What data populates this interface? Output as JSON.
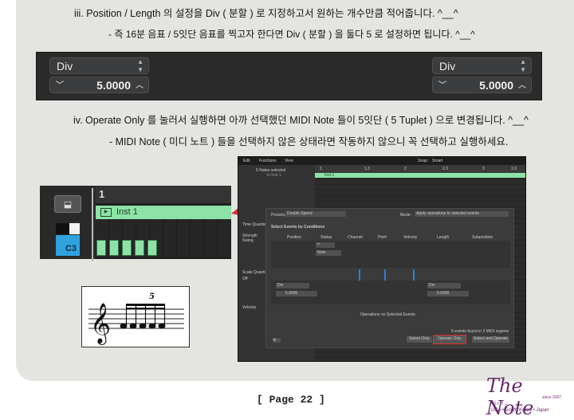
{
  "step3": {
    "line1": "iii. Position / Length 의 설정을 Div ( 분할 ) 로 지정하고서 원하는 개수만큼 적어줍니다. ^__^",
    "line2": "- 즉 16분 음표 / 5잇단 음표를 찍고자 한다면 Div ( 분할 ) 을 둘다 5 로 설정하면 됩니다. ^__^"
  },
  "div_bar": {
    "left_mode": "Div",
    "left_value": "5.0000",
    "right_mode": "Div",
    "right_value": "5.0000"
  },
  "step4": {
    "line1": "iv. Operate Only 를 눌러서 실행하면 아까 선택했던 MIDI Note 들이 5잇단 ( 5 Tuplet ) 으로 변경됩니다. ^__^",
    "line2": "- MIDI Note ( 미디 노트 ) 들을 선택하지 않은 상태라면 작동하지 않으니 꼭 선택하고 실행하세요."
  },
  "region_editor": {
    "bar_number": "1",
    "region_name": "Inst 1",
    "key_label": "C3"
  },
  "notation": {
    "tuplet_number": "5"
  },
  "logic_window": {
    "menu": [
      "Edit",
      "Functions",
      "View"
    ],
    "snap_label": "Snap:",
    "snap_value": "Smart",
    "notes_selected": "5 Notes selected",
    "notes_selected_sub": "in Inst 1",
    "ruler": [
      "1",
      "1.3",
      "2",
      "2.3",
      "3",
      "3.3"
    ],
    "region_name": "Inst 1",
    "side_labels": [
      "Time Quantize",
      "Strength",
      "Swing",
      "Scale Quantize",
      "Off",
      "Velocity"
    ],
    "dialog": {
      "presets_label": "Presets:",
      "presets_value": "Double Speed",
      "mode_label": "Mode:",
      "mode_value": "Apply operations to selected events",
      "section_title": "Select Events by Conditions",
      "columns": [
        "Position",
        "Status",
        "Channel",
        "Pitch",
        "Velocity",
        "Length",
        "Subposition"
      ],
      "status_op": "=",
      "status_value": "Note",
      "left_mode": "Div",
      "left_value": "5.0000",
      "right_mode": "Div",
      "right_value": "5.0000",
      "ops_title": "Operations on Selected Events",
      "events_found": "5 events found in 3 MIDI regions",
      "btn_select_only": "Select Only",
      "btn_operate_only": "Operate Only",
      "btn_select_operate": "Select and Operate"
    }
  },
  "footer": {
    "page": "[ Page 22 ]"
  },
  "logo": {
    "brand": "The Note",
    "since": "since 2007",
    "tagline": "USA • South Korea • Japan"
  },
  "colors": {
    "panel": "#e4e5e0",
    "region_green": "#8de3a7",
    "highlight_red": "#e03030",
    "key_blue": "#2fa3df",
    "logo_purple": "#6a2a6c"
  }
}
